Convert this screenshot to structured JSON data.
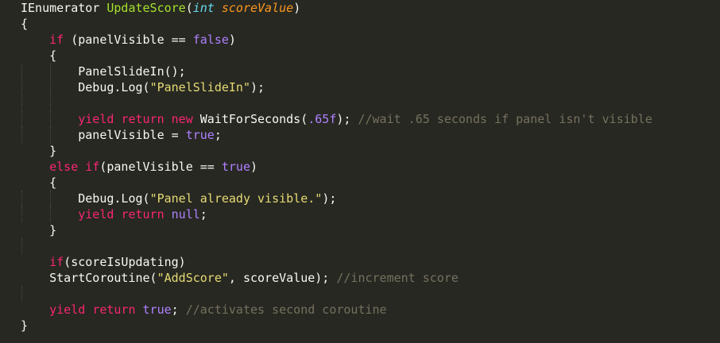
{
  "editor": {
    "lines": [
      [
        [
          "n",
          "IEnumerator "
        ],
        [
          "f",
          "UpdateScore"
        ],
        [
          "n",
          "("
        ],
        [
          "t",
          "int"
        ],
        [
          "n",
          " "
        ],
        [
          "p",
          "scoreValue"
        ],
        [
          "n",
          ")"
        ]
      ],
      [
        [
          "n",
          "{"
        ]
      ],
      [
        [
          "n",
          "    "
        ],
        [
          "k",
          "if"
        ],
        [
          "n",
          " (panelVisible == "
        ],
        [
          "c",
          "false"
        ],
        [
          "n",
          ")"
        ]
      ],
      [
        [
          "n",
          "    {"
        ]
      ],
      [
        [
          "n",
          "        PanelSlideIn();"
        ]
      ],
      [
        [
          "n",
          "        Debug.Log("
        ],
        [
          "s",
          "\"PanelSlideIn\""
        ],
        [
          "n",
          ");"
        ]
      ],
      [],
      [
        [
          "n",
          "        "
        ],
        [
          "k",
          "yield"
        ],
        [
          "n",
          " "
        ],
        [
          "k",
          "return"
        ],
        [
          "n",
          " "
        ],
        [
          "k",
          "new"
        ],
        [
          "n",
          " WaitForSeconds("
        ],
        [
          "c",
          ".65f"
        ],
        [
          "n",
          "); "
        ],
        [
          "cm",
          "//wait .65 seconds if panel isn't visible"
        ]
      ],
      [
        [
          "n",
          "        panelVisible = "
        ],
        [
          "c",
          "true"
        ],
        [
          "n",
          ";"
        ]
      ],
      [
        [
          "n",
          "    }"
        ]
      ],
      [
        [
          "n",
          "    "
        ],
        [
          "k",
          "else"
        ],
        [
          "n",
          " "
        ],
        [
          "k",
          "if"
        ],
        [
          "n",
          "(panelVisible == "
        ],
        [
          "c",
          "true"
        ],
        [
          "n",
          ")"
        ]
      ],
      [
        [
          "n",
          "    {"
        ]
      ],
      [
        [
          "n",
          "        Debug.Log("
        ],
        [
          "s",
          "\"Panel already visible.\""
        ],
        [
          "n",
          ");"
        ]
      ],
      [
        [
          "n",
          "        "
        ],
        [
          "k",
          "yield"
        ],
        [
          "n",
          " "
        ],
        [
          "k",
          "return"
        ],
        [
          "n",
          " "
        ],
        [
          "c",
          "null"
        ],
        [
          "n",
          ";"
        ]
      ],
      [
        [
          "n",
          "    }"
        ]
      ],
      [],
      [
        [
          "n",
          "    "
        ],
        [
          "k",
          "if"
        ],
        [
          "n",
          "(scoreIsUpdating)"
        ]
      ],
      [
        [
          "n",
          "    StartCoroutine("
        ],
        [
          "s",
          "\"AddScore\""
        ],
        [
          "n",
          ", scoreValue); "
        ],
        [
          "cm",
          "//increment score"
        ]
      ],
      [],
      [
        [
          "n",
          "    "
        ],
        [
          "k",
          "yield"
        ],
        [
          "n",
          " "
        ],
        [
          "k",
          "return"
        ],
        [
          "n",
          " "
        ],
        [
          "c",
          "true"
        ],
        [
          "n",
          "; "
        ],
        [
          "cm",
          "//activates second coroutine"
        ]
      ],
      [
        [
          "n",
          "}"
        ]
      ]
    ]
  }
}
